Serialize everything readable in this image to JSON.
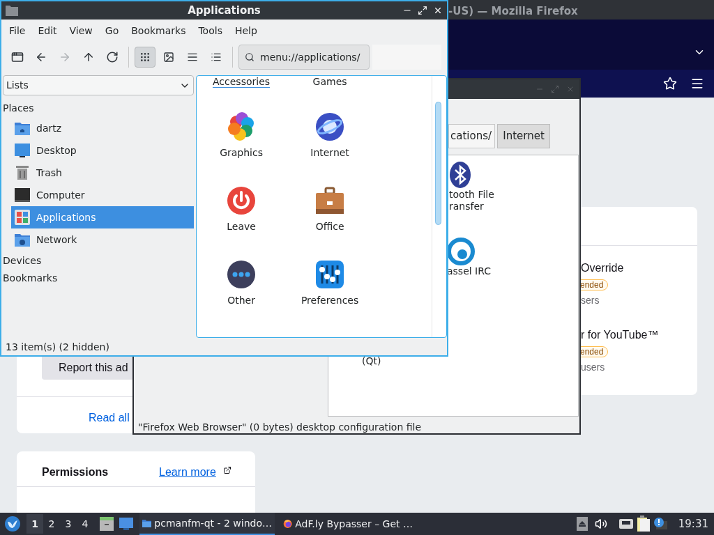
{
  "browser": {
    "title": "-US) — Mozilla Firefox",
    "addons": [
      {
        "name": "Override",
        "badge": "ended",
        "users": "sers"
      },
      {
        "name": "r for YouTube™",
        "badge": "ended",
        "users": "users"
      }
    ],
    "report_button": "Report this ad",
    "read_all": "Read all",
    "permissions": {
      "title": "Permissions",
      "link": "Learn more"
    }
  },
  "back_window": {
    "path": "cations/",
    "crumb": "Internet",
    "items": [
      {
        "kind": "bluetooth",
        "lines": [
          "tooth File",
          "ransfer"
        ]
      },
      {
        "kind": "quassel",
        "lines": [
          "assel IRC"
        ]
      },
      {
        "kind": "none",
        "lines": [
          "(Qt)"
        ]
      }
    ],
    "status": "\"Firefox Web Browser\" (0 bytes) desktop configuration file"
  },
  "window": {
    "title": "Applications",
    "menu": [
      "File",
      "Edit",
      "View",
      "Go",
      "Bookmarks",
      "Tools",
      "Help"
    ],
    "nav_buttons": [
      {
        "kind": "new-tab",
        "disabled": false
      },
      {
        "kind": "back",
        "disabled": false
      },
      {
        "kind": "forward",
        "disabled": true
      },
      {
        "kind": "up",
        "disabled": false
      },
      {
        "kind": "reload",
        "disabled": false
      }
    ],
    "view_modes": [
      {
        "kind": "icons",
        "selected": true
      },
      {
        "kind": "thumbnails",
        "selected": false
      },
      {
        "kind": "compact",
        "selected": false
      },
      {
        "kind": "details",
        "selected": false
      }
    ],
    "path": "menu://applications/",
    "side_selector": "Lists",
    "places_heading": "Places",
    "places": [
      {
        "kind": "home",
        "label": "dartz",
        "selected": false
      },
      {
        "kind": "desktop",
        "label": "Desktop",
        "selected": false
      },
      {
        "kind": "trash",
        "label": "Trash",
        "selected": false
      },
      {
        "kind": "computer",
        "label": "Computer",
        "selected": false
      },
      {
        "kind": "applications",
        "label": "Applications",
        "selected": true
      },
      {
        "kind": "network",
        "label": "Network",
        "selected": false
      }
    ],
    "sections": [
      "Devices",
      "Bookmarks"
    ],
    "top_labels": [
      "Accessories",
      "Games"
    ],
    "items": [
      {
        "kind": "graphics",
        "label": "Graphics"
      },
      {
        "kind": "internet",
        "label": "Internet"
      },
      {
        "kind": "leave",
        "label": "Leave"
      },
      {
        "kind": "office",
        "label": "Office"
      },
      {
        "kind": "other",
        "label": "Other"
      },
      {
        "kind": "preferences",
        "label": "Preferences"
      }
    ],
    "status": "13 item(s) (2 hidden)"
  },
  "taskbar": {
    "desktops": [
      {
        "label": "1",
        "selected": true
      },
      {
        "label": "2",
        "selected": false
      },
      {
        "label": "3",
        "selected": false
      },
      {
        "label": "4",
        "selected": false
      }
    ],
    "tasks": [
      {
        "kind": "folder",
        "label": "pcmanfm-qt - 2 windo…",
        "selected": true
      },
      {
        "kind": "firefox",
        "label": "AdF.ly Bypasser – Get …",
        "selected": false
      }
    ],
    "clock": "19:31"
  }
}
